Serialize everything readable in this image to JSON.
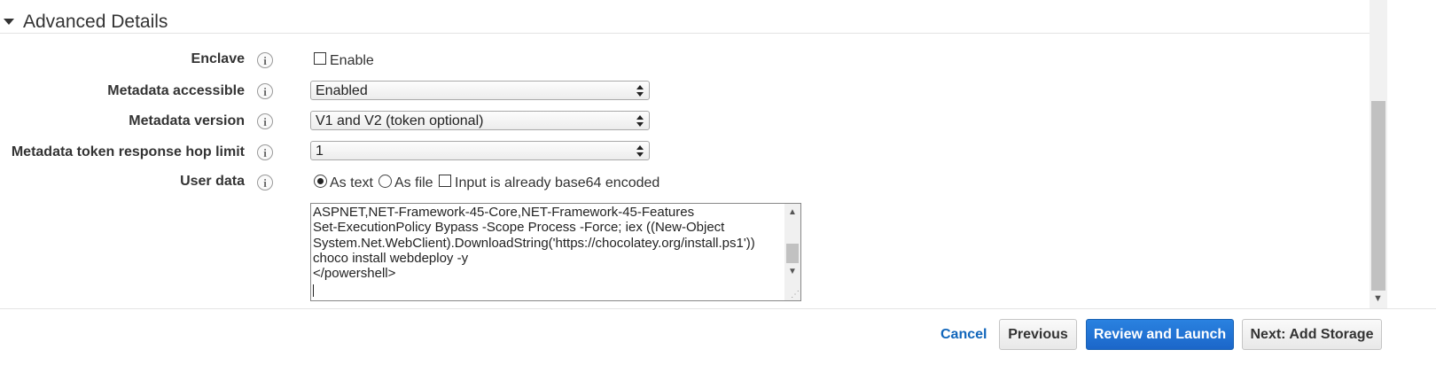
{
  "section": {
    "title": "Advanced Details"
  },
  "rows": {
    "enclave": {
      "label": "Enclave",
      "option_label": "Enable"
    },
    "metadata_accessible": {
      "label": "Metadata accessible",
      "value": "Enabled"
    },
    "metadata_version": {
      "label": "Metadata version",
      "value": "V1 and V2 (token optional)"
    },
    "hop_limit": {
      "label": "Metadata token response hop limit",
      "value": "1"
    },
    "user_data": {
      "label": "User data",
      "as_text": "As text",
      "as_file": "As file",
      "base64": "Input is already base64 encoded",
      "selected": "As text",
      "base64_checked": false,
      "text_lines": [
        "ASPNET,NET-Framework-45-Core,NET-Framework-45-Features",
        "Set-ExecutionPolicy Bypass -Scope Process -Force; iex ((New-Object",
        "System.Net.WebClient).DownloadString('https://chocolatey.org/install.ps1'))",
        "choco install webdeploy -y",
        "</powershell>"
      ]
    }
  },
  "info_glyph": "i",
  "footer": {
    "cancel": "Cancel",
    "previous": "Previous",
    "review": "Review and Launch",
    "next": "Next: Add Storage"
  },
  "icons": [
    "caret-down-icon",
    "info-icon",
    "select-arrows-icon",
    "scroll-up-icon",
    "scroll-down-icon",
    "resize-grip-icon"
  ],
  "colors": {
    "primary": "#1b66c9",
    "link": "#1166bb",
    "text": "#333333"
  }
}
